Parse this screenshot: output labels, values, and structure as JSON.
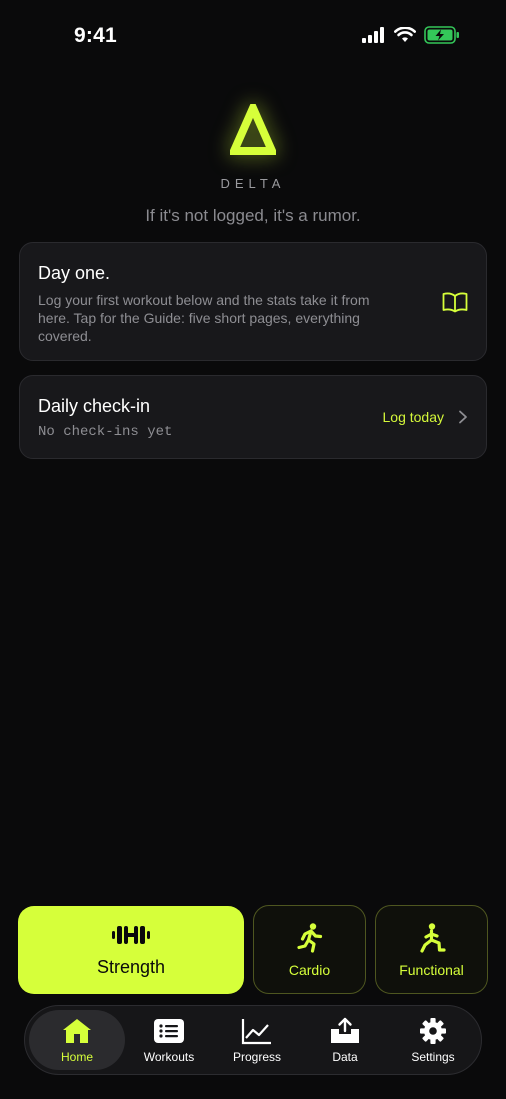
{
  "status_bar": {
    "time": "9:41"
  },
  "brand": {
    "name": "DELTA",
    "tagline": "If it's not logged, it's a rumor.",
    "accent": "#d6ff3a"
  },
  "cards": {
    "day_one": {
      "title": "Day one.",
      "body": "Log your first workout below and the stats take it from here. Tap for the Guide: five short pages, everything covered.",
      "icon": "book-icon"
    },
    "checkin": {
      "title": "Daily check-in",
      "subtitle": "No check-ins yet",
      "cta": "Log today"
    }
  },
  "workout_types": {
    "strength": {
      "label": "Strength",
      "icon": "dumbbell-icon"
    },
    "cardio": {
      "label": "Cardio",
      "icon": "running-icon"
    },
    "functional": {
      "label": "Functional",
      "icon": "lunge-icon"
    }
  },
  "tabbar": {
    "items": [
      {
        "label": "Home",
        "icon": "home-icon",
        "active": true
      },
      {
        "label": "Workouts",
        "icon": "list-icon",
        "active": false
      },
      {
        "label": "Progress",
        "icon": "chart-icon",
        "active": false
      },
      {
        "label": "Data",
        "icon": "upload-tray-icon",
        "active": false
      },
      {
        "label": "Settings",
        "icon": "gear-icon",
        "active": false
      }
    ]
  }
}
